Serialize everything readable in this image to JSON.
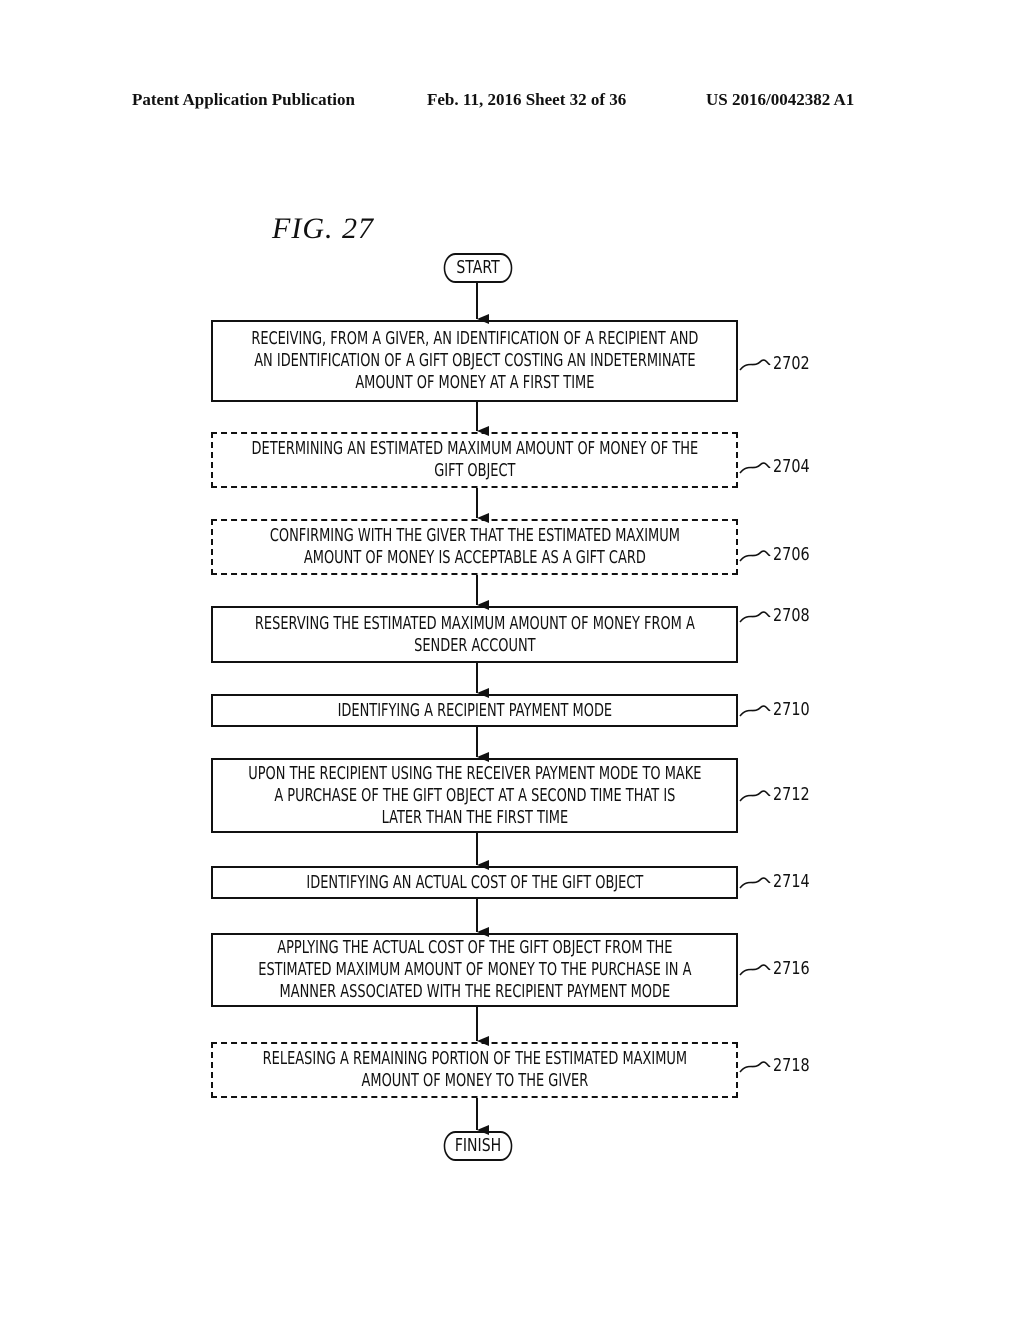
{
  "header": {
    "publication": "Patent Application Publication",
    "date_sheet": "Feb. 11, 2016  Sheet 32 of 36",
    "number": "US 2016/0042382 A1"
  },
  "figure": {
    "label": "FIG. 27"
  },
  "flow": {
    "start": "START",
    "finish": "FINISH",
    "steps": [
      {
        "ref": "2702",
        "style": "solid",
        "text": "RECEIVING, FROM A GIVER, AN IDENTIFICATION OF A RECIPIENT AND\nAN IDENTIFICATION OF A GIFT OBJECT COSTING AN INDETERMINATE\nAMOUNT OF MONEY AT A FIRST TIME"
      },
      {
        "ref": "2704",
        "style": "dashed",
        "text": "DETERMINING AN ESTIMATED MAXIMUM AMOUNT OF MONEY OF THE\nGIFT OBJECT"
      },
      {
        "ref": "2706",
        "style": "dashed",
        "text": "CONFIRMING WITH THE GIVER THAT THE ESTIMATED MAXIMUM\nAMOUNT OF MONEY IS ACCEPTABLE AS A GIFT CARD"
      },
      {
        "ref": "2708",
        "style": "solid",
        "text": "RESERVING THE ESTIMATED MAXIMUM AMOUNT OF MONEY FROM A\nSENDER ACCOUNT"
      },
      {
        "ref": "2710",
        "style": "solid",
        "text": "IDENTIFYING A RECIPIENT PAYMENT MODE"
      },
      {
        "ref": "2712",
        "style": "solid",
        "text": "UPON THE RECIPIENT USING THE RECEIVER PAYMENT MODE TO MAKE\nA PURCHASE OF THE GIFT OBJECT AT A SECOND TIME THAT IS\nLATER THAN THE FIRST TIME"
      },
      {
        "ref": "2714",
        "style": "solid",
        "text": "IDENTIFYING AN ACTUAL COST OF THE GIFT OBJECT"
      },
      {
        "ref": "2716",
        "style": "solid",
        "text": "APPLYING THE ACTUAL COST OF THE GIFT OBJECT FROM THE\nESTIMATED MAXIMUM AMOUNT OF MONEY TO THE PURCHASE IN A\nMANNER ASSOCIATED WITH THE RECIPIENT PAYMENT MODE"
      },
      {
        "ref": "2718",
        "style": "dashed",
        "text": "RELEASING A REMAINING PORTION OF THE ESTIMATED MAXIMUM\nAMOUNT OF MONEY TO THE GIVER"
      }
    ]
  }
}
